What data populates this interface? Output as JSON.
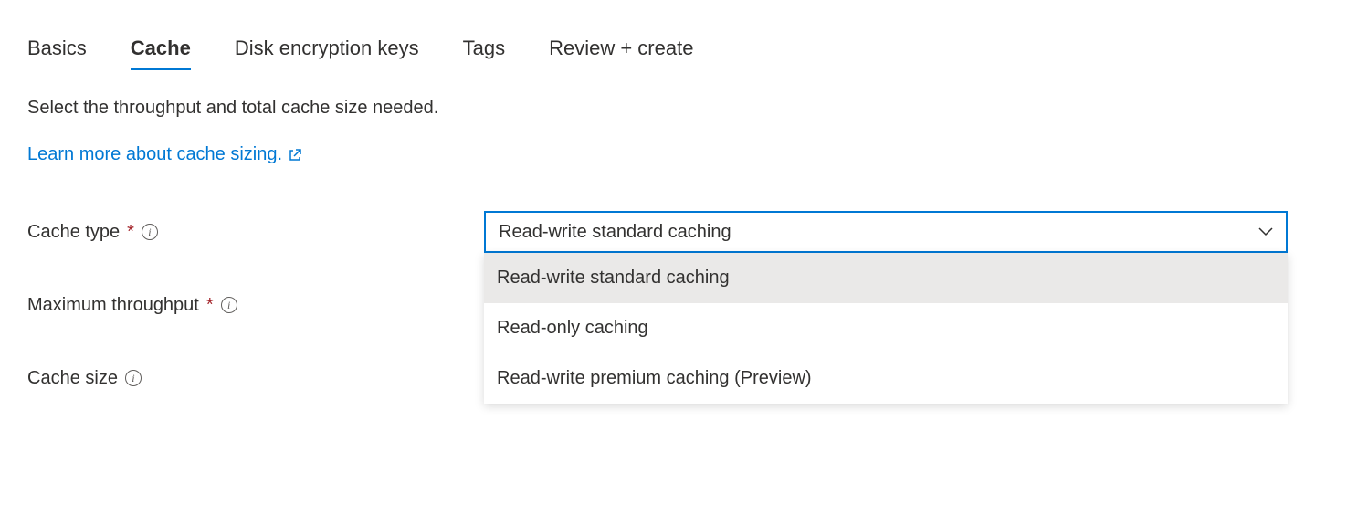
{
  "tabs": [
    {
      "label": "Basics"
    },
    {
      "label": "Cache"
    },
    {
      "label": "Disk encryption keys"
    },
    {
      "label": "Tags"
    },
    {
      "label": "Review + create"
    }
  ],
  "active_tab_index": 1,
  "description": "Select the throughput and total cache size needed.",
  "learn_more": {
    "label": "Learn more about cache sizing."
  },
  "fields": {
    "cache_type": {
      "label": "Cache type",
      "required": true,
      "selected": "Read-write standard caching",
      "options": [
        "Read-write standard caching",
        "Read-only caching",
        "Read-write premium caching (Preview)"
      ]
    },
    "max_throughput": {
      "label": "Maximum throughput",
      "required": true
    },
    "cache_size": {
      "label": "Cache size",
      "required": false
    }
  }
}
